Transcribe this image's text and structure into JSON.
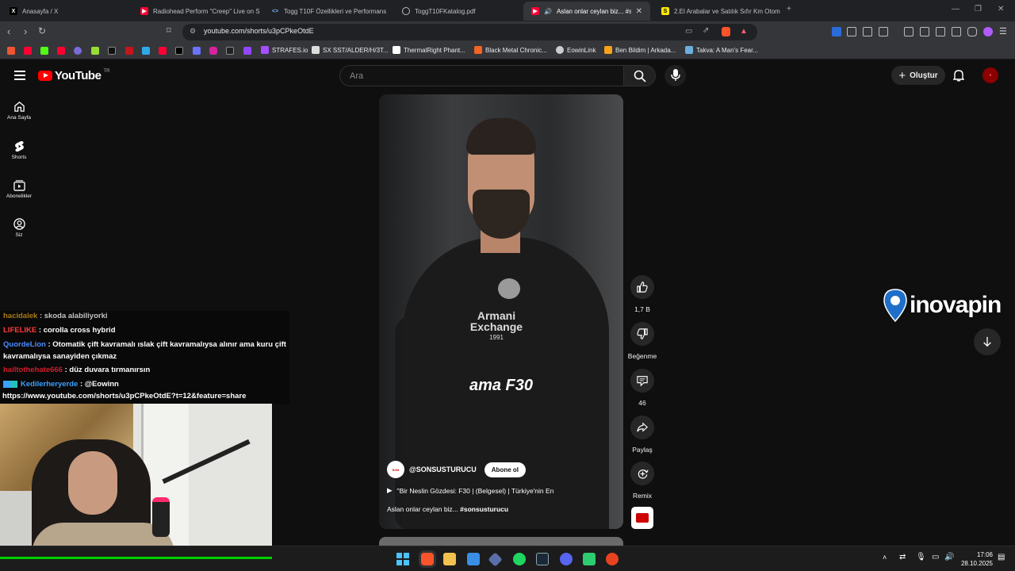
{
  "browser": {
    "tabs": [
      {
        "label": "Anasayfa / X",
        "favicon": "x-icon",
        "active": false
      },
      {
        "label": "Radiohead Perform \"Creep\" Live on S",
        "favicon": "youtube-icon",
        "active": false
      },
      {
        "label": "Togg T10F Özellikleri ve Performans",
        "favicon": "code-icon",
        "active": false
      },
      {
        "label": "ToggT10FKatalog.pdf",
        "favicon": "globe-icon",
        "active": false
      },
      {
        "label": "Aslan onlar ceylan biz... #son",
        "favicon": "youtube-icon",
        "active": true
      },
      {
        "label": "2.El Arabalar ve Satılık Sıfır Km Otom",
        "favicon": "s-icon",
        "active": false
      }
    ],
    "url": "youtube.com/shorts/u3pCPkeOtdE",
    "bookmarks": [
      {
        "label": "STRAFES.io"
      },
      {
        "label": "SX SST/ALDER/H/3T..."
      },
      {
        "label": "ThermalRight Phant..."
      },
      {
        "label": "Black Metal Chronic..."
      },
      {
        "label": "EowinLink"
      },
      {
        "label": "Ben Bildim | Arkada..."
      },
      {
        "label": "Takva: A Man's Fear..."
      }
    ]
  },
  "youtube": {
    "logo_text": "YouTube",
    "logo_region": "TR",
    "search_placeholder": "Ara",
    "create_label": "Oluştur",
    "sidebar": [
      {
        "label": "Ana Sayfa",
        "icon": "home-icon"
      },
      {
        "label": "Shorts",
        "icon": "shorts-icon"
      },
      {
        "label": "Abonelikler",
        "icon": "subscriptions-icon"
      },
      {
        "label": "Siz",
        "icon": "user-icon"
      }
    ],
    "short": {
      "caption": "ama F30",
      "shirt_logo_line1": "Armani",
      "shirt_logo_line2": "Exchange",
      "shirt_logo_year": "1991",
      "channel": "@SONSUSTURUCU",
      "subscribe_label": "Abone ol",
      "music": "\"Bir Neslin Gözdesi: F30 | (Belgesel) |  Türkiye'nin En",
      "description": "Aslan onlar ceylan biz...",
      "hashtag": "#sonsusturucu"
    },
    "actions": {
      "like_count": "1,7 B",
      "dislike_label": "Beğenme",
      "comment_count": "46",
      "share_label": "Paylaş",
      "remix_label": "Remix"
    },
    "overlay_logo": "inovapin"
  },
  "stream_chat": [
    {
      "user": "hacidalek",
      "message": "skoda alabiliyorki",
      "color": "#e0a020"
    },
    {
      "user": "LIFELIKE",
      "message": "corolla cross hybrid",
      "color": "#ff3b3b"
    },
    {
      "user": "QuordeLion",
      "message": "Otomatik çift kavramalı ıslak çift kavramalıysa alınır ama kuru çift",
      "color": "#4a8cff"
    },
    {
      "user": "",
      "message": "kavramalıysa sanayiden çıkmaz",
      "color": "#ffffff"
    },
    {
      "user": "hailtothehate666",
      "message": "düz duvara tırmanırsın",
      "color": "#d01e2e"
    },
    {
      "user": "Kedilerheryerde",
      "message": "@Eowinn",
      "color": "#3aa0ff"
    },
    {
      "user": "",
      "message": "https://www.youtube.com/shorts/u3pCPkeOtdE?t=12&feature=share",
      "color": "#ffffff"
    }
  ],
  "taskbar": {
    "time": "17:06",
    "date": "28.10.2025"
  }
}
